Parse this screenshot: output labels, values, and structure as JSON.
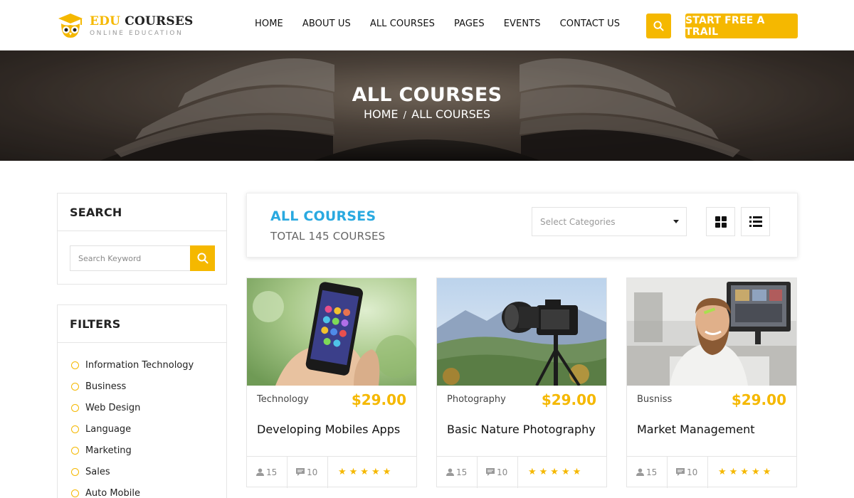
{
  "brand": {
    "name_part1": "EDU",
    "name_part2": "COURSES",
    "tagline": "ONLINE EDUCATION",
    "accent_color": "#f5b800"
  },
  "nav": {
    "items": [
      "HOME",
      "ABOUT US",
      "ALL COURSES",
      "PAGES",
      "EVENTS",
      "CONTACT US"
    ],
    "search_icon": "search-icon",
    "cta_label": "START FREE A TRAIL"
  },
  "hero": {
    "title": "ALL COURSES",
    "breadcrumb_home": "HOME",
    "breadcrumb_sep": "/",
    "breadcrumb_current": "ALL COURSES"
  },
  "sidebar": {
    "search_title": "SEARCH",
    "search_placeholder": "Search Keyword",
    "filters_title": "FILTERS",
    "filters": [
      "Information Technology",
      "Business",
      "Web Design",
      "Language",
      "Marketing",
      "Sales",
      "Auto Mobile"
    ]
  },
  "toolbar": {
    "title": "ALL COURSES",
    "title_color": "#29a9e0",
    "total": "TOTAL 145 COURSES",
    "category_placeholder": "Select Categories",
    "grid_view_icon": "grid-icon",
    "list_view_icon": "list-icon"
  },
  "courses": [
    {
      "category": "Technology",
      "price": "$29.00",
      "title": "Developing Mobiles Apps",
      "students": "15",
      "comments": "10",
      "rating": 5,
      "stars": "★★★★★"
    },
    {
      "category": "Photography",
      "price": "$29.00",
      "title": "Basic Nature Photography",
      "students": "15",
      "comments": "10",
      "rating": 5,
      "stars": "★★★★★"
    },
    {
      "category": "Busniss",
      "price": "$29.00",
      "title": "Market Management",
      "students": "15",
      "comments": "10",
      "rating": 5,
      "stars": "★★★★★"
    }
  ]
}
